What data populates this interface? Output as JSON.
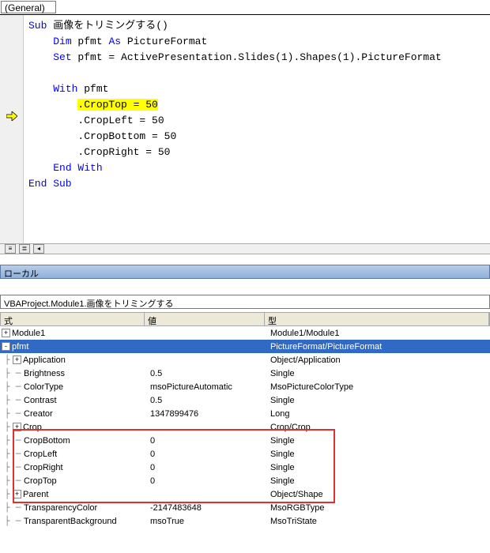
{
  "dropdown": {
    "value": "(General)"
  },
  "code": {
    "line1_sub": "Sub",
    "line1_name": " 画像をトリミングする()",
    "line2_dim": "Dim",
    "line2_mid": " pfmt ",
    "line2_as": "As",
    "line2_type": " PictureFormat",
    "line3_set": "Set",
    "line3_rest": " pfmt = ActivePresentation.Slides(1).Shapes(1).PictureFormat",
    "line5_with": "With",
    "line5_rest": " pfmt",
    "line6": ".CropTop = 50",
    "line7": ".CropLeft = 50",
    "line8": ".CropBottom = 50",
    "line9": ".CropRight = 50",
    "line10": "End With",
    "line11": "End Sub"
  },
  "locals": {
    "title": "ローカル",
    "context": "VBAProject.Module1.画像をトリミングする",
    "headers": {
      "expr": "式",
      "val": "値",
      "type": "型"
    },
    "rows": [
      {
        "indent": 0,
        "toggle": "+",
        "name": "Module1",
        "val": "",
        "type": "Module1/Module1",
        "sel": false
      },
      {
        "indent": 0,
        "toggle": "-",
        "name": "pfmt",
        "val": "",
        "type": "PictureFormat/PictureFormat",
        "sel": true
      },
      {
        "indent": 1,
        "toggle": "+",
        "name": "Application",
        "val": "",
        "type": "Object/Application",
        "sel": false
      },
      {
        "indent": 1,
        "toggle": "",
        "name": "Brightness",
        "val": "0.5",
        "type": "Single",
        "sel": false
      },
      {
        "indent": 1,
        "toggle": "",
        "name": "ColorType",
        "val": "msoPictureAutomatic",
        "type": "MsoPictureColorType",
        "sel": false
      },
      {
        "indent": 1,
        "toggle": "",
        "name": "Contrast",
        "val": "0.5",
        "type": "Single",
        "sel": false
      },
      {
        "indent": 1,
        "toggle": "",
        "name": "Creator",
        "val": "1347899476",
        "type": "Long",
        "sel": false
      },
      {
        "indent": 1,
        "toggle": "+",
        "name": "Crop",
        "val": "",
        "type": "Crop/Crop",
        "sel": false
      },
      {
        "indent": 1,
        "toggle": "",
        "name": "CropBottom",
        "val": "0",
        "type": "Single",
        "sel": false
      },
      {
        "indent": 1,
        "toggle": "",
        "name": "CropLeft",
        "val": "0",
        "type": "Single",
        "sel": false
      },
      {
        "indent": 1,
        "toggle": "",
        "name": "CropRight",
        "val": "0",
        "type": "Single",
        "sel": false
      },
      {
        "indent": 1,
        "toggle": "",
        "name": "CropTop",
        "val": "0",
        "type": "Single",
        "sel": false
      },
      {
        "indent": 1,
        "toggle": "+",
        "name": "Parent",
        "val": "",
        "type": "Object/Shape",
        "sel": false
      },
      {
        "indent": 1,
        "toggle": "",
        "name": "TransparencyColor",
        "val": "-2147483648",
        "type": "MsoRGBType",
        "sel": false
      },
      {
        "indent": 1,
        "toggle": "",
        "name": "TransparentBackground",
        "val": "msoTrue",
        "type": "MsoTriState",
        "sel": false
      }
    ]
  }
}
